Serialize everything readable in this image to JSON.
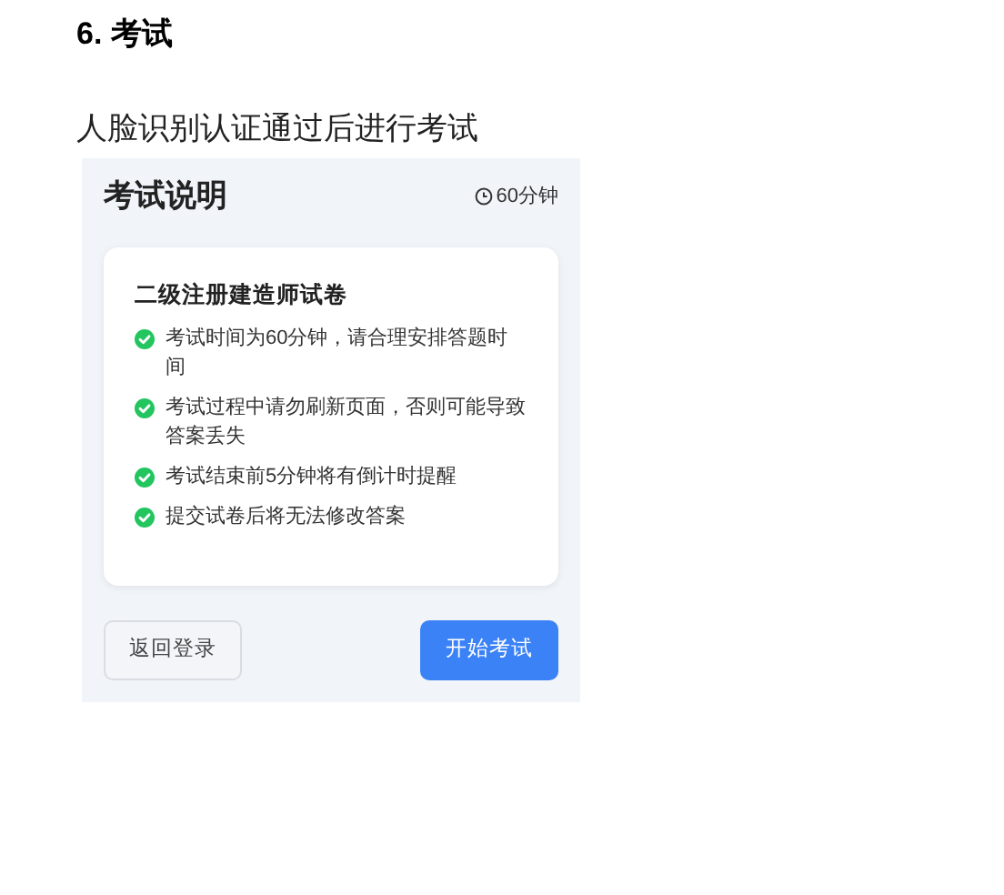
{
  "heading": "6. 考试",
  "intro": "人脸识别认证通过后进行考试",
  "screen": {
    "title": "考试说明",
    "duration": "60分钟",
    "card": {
      "title": "二级注册建造师试卷",
      "rules": [
        "考试时间为60分钟，请合理安排答题时间",
        "考试过程中请勿刷新页面，否则可能导致答案丢失",
        "考试结束前5分钟将有倒计时提醒",
        "提交试卷后将无法修改答案"
      ]
    },
    "buttons": [
      {
        "label": "返回登录",
        "kind": "secondary"
      },
      {
        "label": "开始考试",
        "kind": "primary"
      }
    ]
  }
}
